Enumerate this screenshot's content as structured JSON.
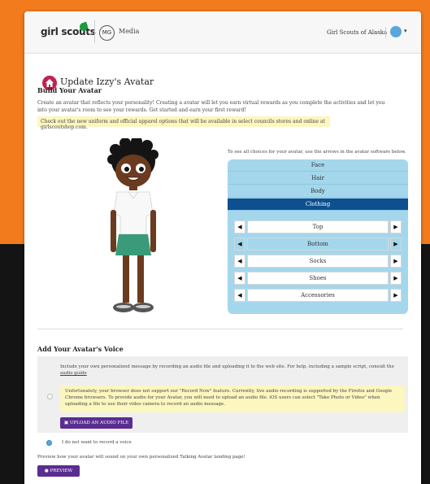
{
  "header": {
    "logo_text": "girl scouts",
    "badge_text": "MG",
    "media_label": "Media",
    "council_name": "Girl Scouts of Alaska",
    "caret": "▾"
  },
  "page": {
    "title": "Update Izzy's Avatar"
  },
  "build": {
    "heading": "Build Your Avatar",
    "description": "Create an avatar that reflects your personality! Creating a avatar will let you earn virtual rewards as you complete the activities and let you into your avatar's room to see your rewards. Get started and earn your first reward!",
    "note": "Check out the new uniform and official apparel options that will be available in select councils stores and online at girlscoutshop.com.",
    "hint": "To see all choices for your avatar, use the arrows in the avatar software below."
  },
  "chooser": {
    "categories": [
      "Face",
      "Hair",
      "Body",
      "Clothing"
    ],
    "active_category": "Clothing",
    "options": [
      "Top",
      "Bottom",
      "Socks",
      "Shoes",
      "Accessories"
    ],
    "selected_option": "Bottom",
    "arrow_left": "◀",
    "arrow_right": "▶"
  },
  "voice": {
    "heading": "Add Your Avatar's Voice",
    "intro": "Include your own personalized message by recording an audio file and uploading it to the web site. For help, including a sample script, consult the",
    "intro_link": "audio guide",
    "warning": "Unfortunately, your browser does not support our \"Record Now\" feature. Currently, live audio recording is supported by the Firefox and Google Chrome browsers. To provide audio for your Avatar, you will need to upload an audio file. iOS users can select \"Take Photo or Video\" when uploading a file to use their video camera to record an audio message.",
    "upload_label": "UPLOAD AN AUDIO FILE",
    "no_record_label": "I do not want to record a voice",
    "preview_text": "Preview how your avatar will sound on your own personalized Talking Avatar landing page!",
    "preview_label": "PREVIEW"
  },
  "colors": {
    "brand_purple": "#5a2d91",
    "chooser_bg": "#a4d7ec",
    "active_tab": "#0d4f8f",
    "home_icon": "#c0234f",
    "page_bg_orange": "#f27b1e"
  }
}
